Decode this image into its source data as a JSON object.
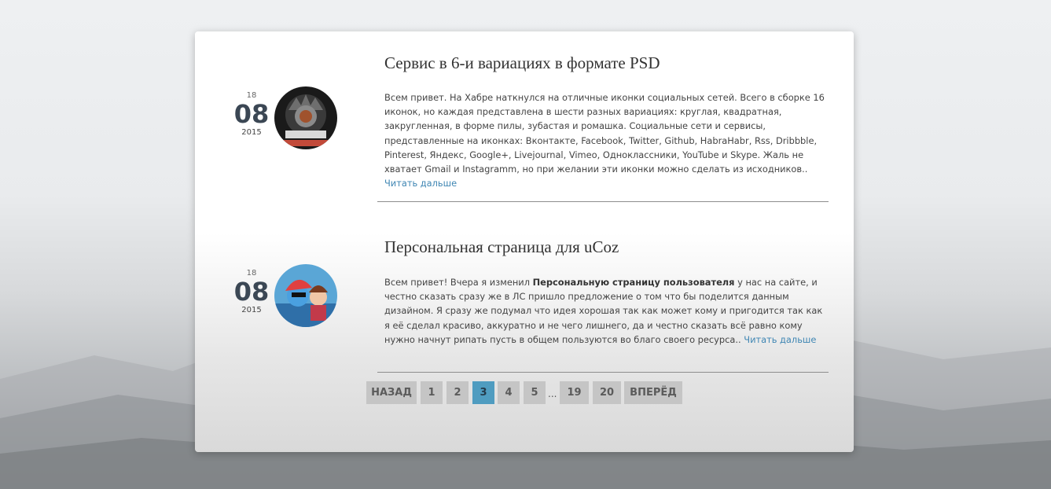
{
  "posts": [
    {
      "day": "18",
      "month": "08",
      "year": "2015",
      "title": "Сервис в 6-и вариациях в формате PSD",
      "text": "Всем привет. На Хабре наткнулся на отличные иконки социальных сетей. Всего в сборке 16 иконок, но каждая представлена в шести разных вариациях: круглая, квадратная, закругленная, в форме пилы, зубастая и ромашка. Социальные сети и сервисы, представленные на иконках: Вконтакте, Facebook, Twitter, Github, HabraHabr, Rss, Dribbble, Pinterest, Яндекс, Google+, Livejournal, Vimeo, Одноклассники, YouTube и Skype. Жаль не хватает Gmail и Instagramm, но при желании эти иконки можно сделать из исходников..",
      "more": "Читать дальше"
    },
    {
      "day": "18",
      "month": "08",
      "year": "2015",
      "title": "Персональная страница для uCoz",
      "text_before": "Всем привет! Вчера я изменил ",
      "text_bold": "Персональную страницу пользователя",
      "text_after": " у нас на сайте, и честно сказать сразу же в ЛС пришло предложение о том что бы поделится данным дизайном. Я сразу же подумал что идея хорошая так как может кому и пригодится так как я её сделал красиво, аккуратно и не чего лишнего, да и честно сказать всё равно кому нужно начнут рипать пусть в общем пользуются во благо своего ресурса..",
      "more": "Читать дальше"
    }
  ],
  "pagination": {
    "prev": "НАЗАД",
    "pages": [
      "1",
      "2",
      "3",
      "4",
      "5"
    ],
    "ellipsis": "...",
    "tail": [
      "19",
      "20"
    ],
    "next": "ВПЕРЁД",
    "current": "3"
  },
  "colors": {
    "accent": "#4f9cc0",
    "link": "#3f86b3",
    "date": "#3b4754"
  }
}
